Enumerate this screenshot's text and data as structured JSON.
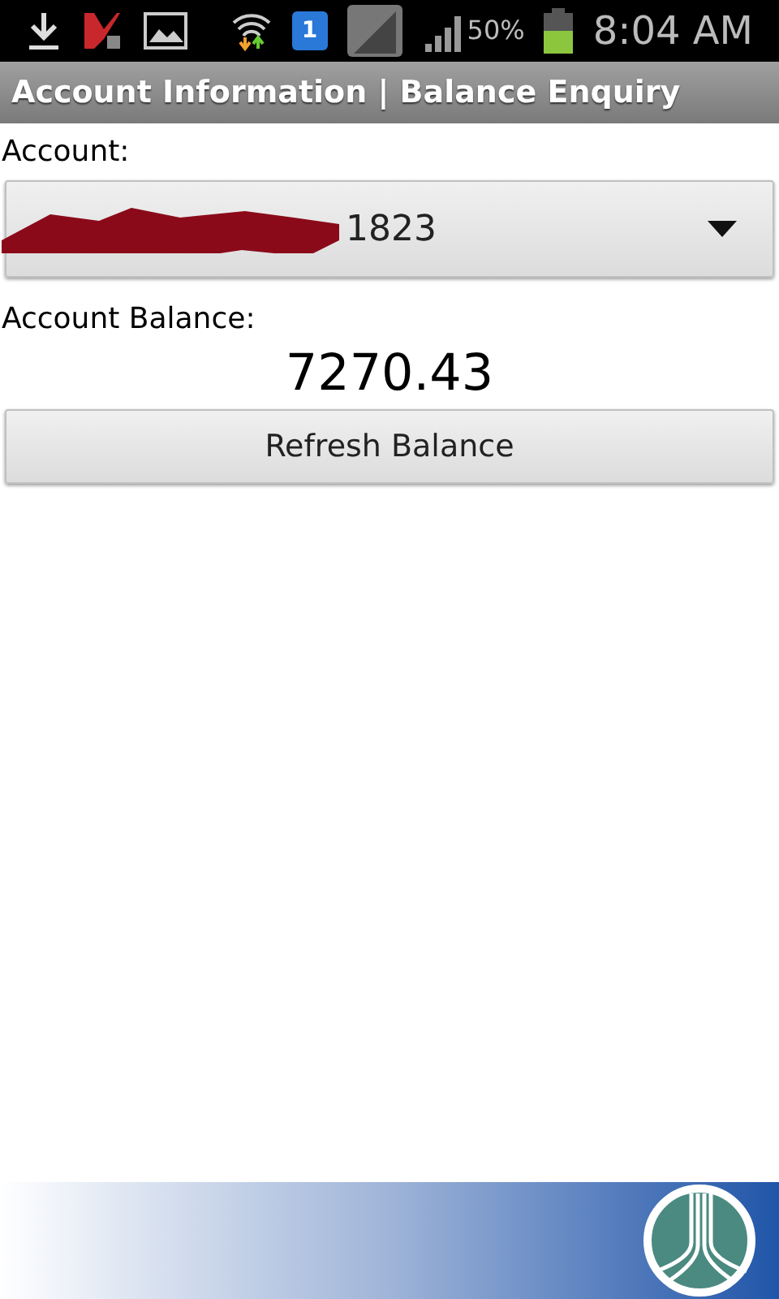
{
  "status_bar": {
    "battery": "50%",
    "time": "8:04 AM",
    "sim_badge": "1"
  },
  "title_bar": {
    "title": "Account Information | Balance Enquiry"
  },
  "account": {
    "label": "Account:",
    "value": "1823",
    "redacted": true
  },
  "balance": {
    "label": "Account Balance:",
    "value": "7270.43"
  },
  "buttons": [
    "Refresh Balance"
  ]
}
